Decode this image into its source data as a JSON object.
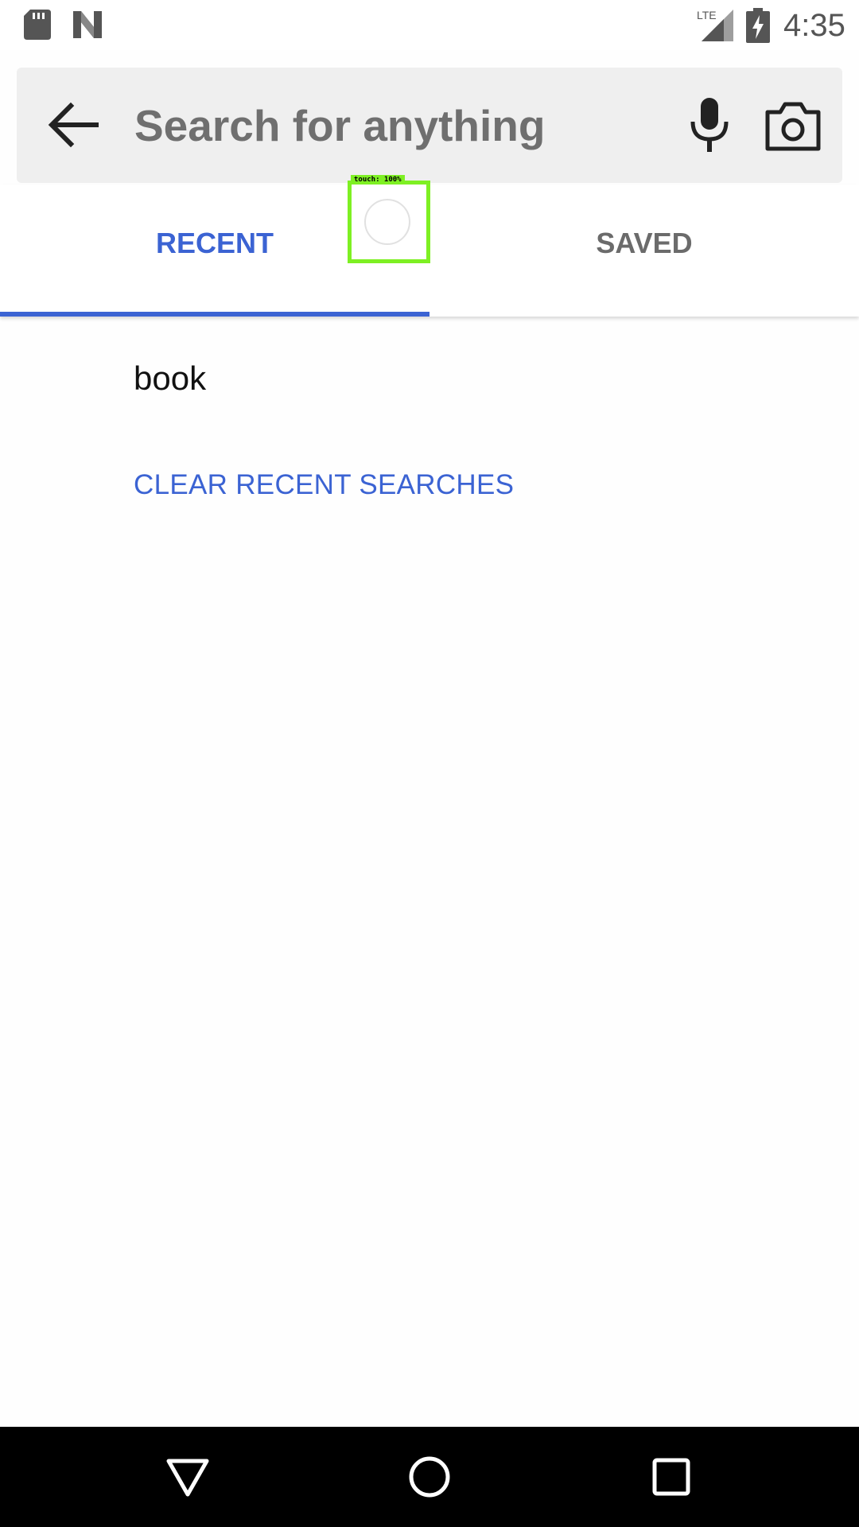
{
  "status_bar": {
    "time": "4:35",
    "network_label": "LTE",
    "left_icons": [
      "sd-card-icon",
      "n-icon"
    ],
    "right_icons": [
      "lte-signal-icon",
      "battery-charging-icon"
    ]
  },
  "search": {
    "placeholder": "Search for anything",
    "value": "",
    "back_icon": "arrow-back-icon",
    "mic_icon": "mic-icon",
    "camera_icon": "camera-icon"
  },
  "tabs": [
    {
      "label": "RECENT",
      "active": true
    },
    {
      "label": "SAVED",
      "active": false
    }
  ],
  "recent_searches": [
    "book"
  ],
  "clear_label": "CLEAR RECENT SEARCHES",
  "touch_indicator": {
    "label": "touch: 100%"
  },
  "nav_bar": [
    "back-triangle-icon",
    "home-circle-icon",
    "recents-square-icon"
  ],
  "colors": {
    "accent": "#3b63d3",
    "tab_inactive": "#6b6b6b",
    "search_bg": "#efefef",
    "touch_box": "#7ef023"
  }
}
